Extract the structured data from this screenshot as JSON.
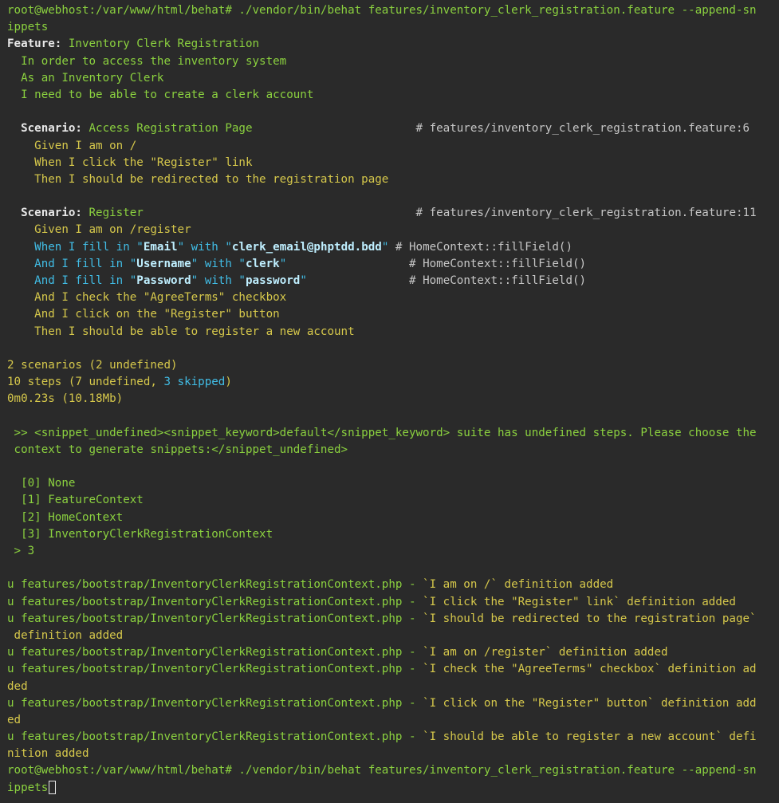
{
  "terminal": {
    "prompt1": [
      "root@webhost:/var/www/html/behat# ./vendor/bin/behat features/inventory_clerk_registration.feature --append-sn",
      "ippets"
    ],
    "feature": {
      "keyword": "Feature:",
      "title": "Inventory Clerk Registration",
      "narrative": [
        "In order to access the inventory system",
        "As an Inventory Clerk",
        "I need to be able to create a clerk account"
      ]
    },
    "scenario1": {
      "keyword": "Scenario:",
      "title": "Access Registration Page",
      "pad": "                        ",
      "location": "# features/inventory_clerk_registration.feature:6",
      "steps": [
        "Given I am on /",
        "When I click the \"Register\" link",
        "Then I should be redirected to the registration page"
      ]
    },
    "scenario2": {
      "keyword": "Scenario:",
      "title": "Register",
      "pad": "                                        ",
      "location": "# features/inventory_clerk_registration.feature:11",
      "step1": "Given I am on /register",
      "fill_steps": [
        {
          "pre": "When I fill in \"",
          "field": "Email",
          "mid": "\" with \"",
          "value": "clerk_email@phptdd.bdd",
          "post": "\"",
          "pad": " ",
          "def": "# HomeContext::fillField()"
        },
        {
          "pre": "And I fill in \"",
          "field": "Username",
          "mid": "\" with \"",
          "value": "clerk",
          "post": "\"",
          "pad": "                  ",
          "def": "# HomeContext::fillField()"
        },
        {
          "pre": "And I fill in \"",
          "field": "Password",
          "mid": "\" with \"",
          "value": "password",
          "post": "\"",
          "pad": "               ",
          "def": "# HomeContext::fillField()"
        }
      ],
      "steps_after": [
        "And I check the \"AgreeTerms\" checkbox",
        "And I click on the \"Register\" button",
        "Then I should be able to register a new account"
      ]
    },
    "summary": {
      "scenarios": "2 scenarios (2 undefined)",
      "steps_pre": "10 steps (7 undefined, ",
      "steps_skipped": "3 skipped",
      "steps_post": ")",
      "time": "0m0.23s (10.18Mb)"
    },
    "snippet_prompt": [
      ">> <snippet_undefined><snippet_keyword>default</snippet_keyword> suite has undefined steps. Please choose the",
      "context to generate snippets:</snippet_undefined>"
    ],
    "options": [
      {
        "index": "[0]",
        "label": "None"
      },
      {
        "index": "[1]",
        "label": "FeatureContext"
      },
      {
        "index": "[2]",
        "label": "HomeContext"
      },
      {
        "index": "[3]",
        "label": "InventoryClerkRegistrationContext"
      }
    ],
    "answer": "> 3",
    "results": [
      {
        "prefix": "u features/bootstrap/InventoryClerkRegistrationContext.php - ",
        "text": "`I am on /` definition added",
        "cont": ""
      },
      {
        "prefix": "u features/bootstrap/InventoryClerkRegistrationContext.php - ",
        "text": "`I click the \"Register\" link` definition added",
        "cont": ""
      },
      {
        "prefix": "u features/bootstrap/InventoryClerkRegistrationContext.php - ",
        "text": "`I should be redirected to the registration page`",
        "cont": " definition added"
      },
      {
        "prefix": "u features/bootstrap/InventoryClerkRegistrationContext.php - ",
        "text": "`I am on /register` definition added",
        "cont": ""
      },
      {
        "prefix": "u features/bootstrap/InventoryClerkRegistrationContext.php - ",
        "text": "`I check the \"AgreeTerms\" checkbox` definition ad",
        "cont": "ded"
      },
      {
        "prefix": "u features/bootstrap/InventoryClerkRegistrationContext.php - ",
        "text": "`I click on the \"Register\" button` definition add",
        "cont": "ed"
      },
      {
        "prefix": "u features/bootstrap/InventoryClerkRegistrationContext.php - ",
        "text": "`I should be able to register a new account` defi",
        "cont": "nition added"
      }
    ],
    "prompt2": [
      "root@webhost:/var/www/html/behat# ./vendor/bin/behat features/inventory_clerk_registration.feature --append-sn",
      "ippets"
    ]
  }
}
